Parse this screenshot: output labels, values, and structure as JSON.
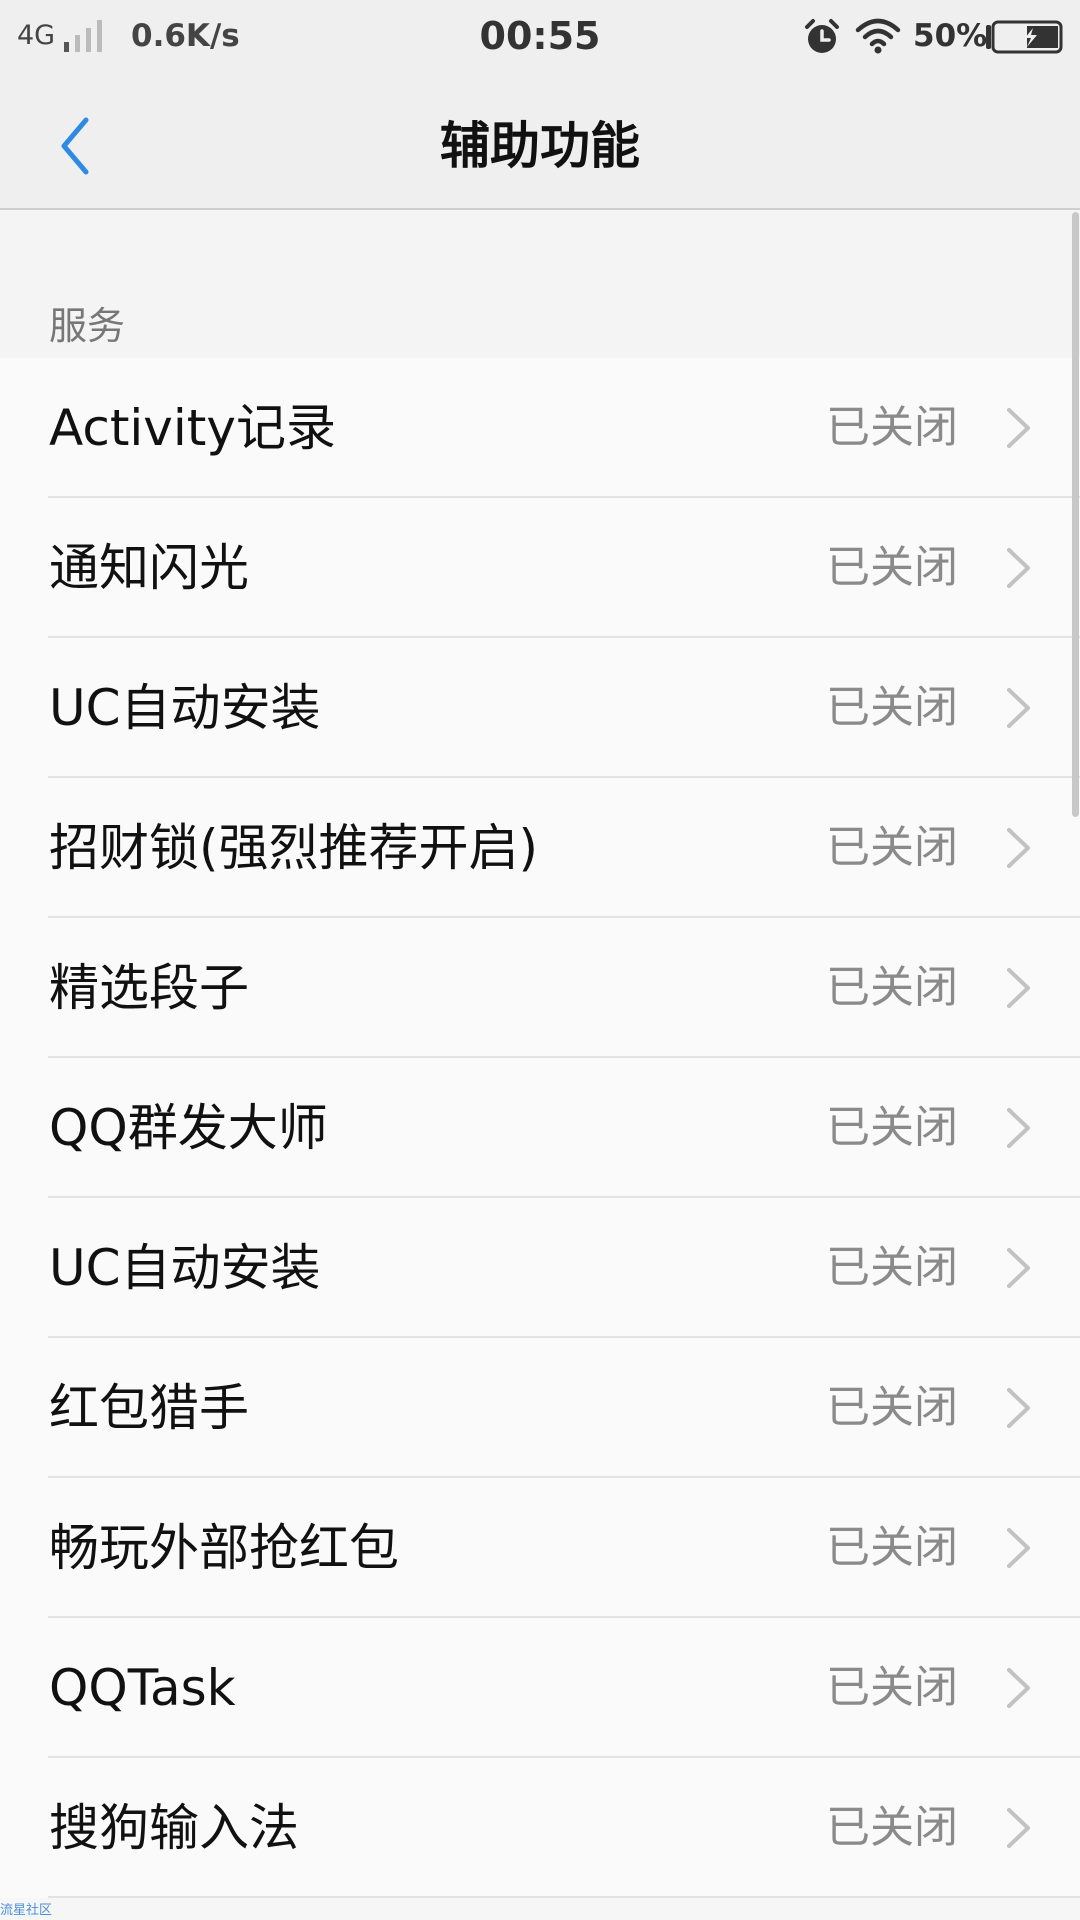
{
  "status_bar": {
    "network": "4G",
    "speed": "0.6K/s",
    "time": "00:55",
    "battery": "50%",
    "icons": [
      "signal-icon",
      "alarm-icon",
      "wifi-icon",
      "battery-icon"
    ]
  },
  "header": {
    "title": "辅助功能",
    "back_icon": "chevron-left-icon",
    "accent_color": "#2f8ae6"
  },
  "section": {
    "label": "服务"
  },
  "services": [
    {
      "label": "Activity记录",
      "status": "已关闭"
    },
    {
      "label": "通知闪光",
      "status": "已关闭"
    },
    {
      "label": "UC自动安装",
      "status": "已关闭"
    },
    {
      "label": "招财锁(强烈推荐开启)",
      "status": "已关闭"
    },
    {
      "label": "精选段子",
      "status": "已关闭"
    },
    {
      "label": "QQ群发大师",
      "status": "已关闭"
    },
    {
      "label": "UC自动安装",
      "status": "已关闭"
    },
    {
      "label": "红包猎手",
      "status": "已关闭"
    },
    {
      "label": "畅玩外部抢红包",
      "status": "已关闭"
    },
    {
      "label": "QQTask",
      "status": "已关闭"
    },
    {
      "label": "搜狗输入法",
      "status": "已关闭"
    }
  ],
  "watermark": "流星社区"
}
